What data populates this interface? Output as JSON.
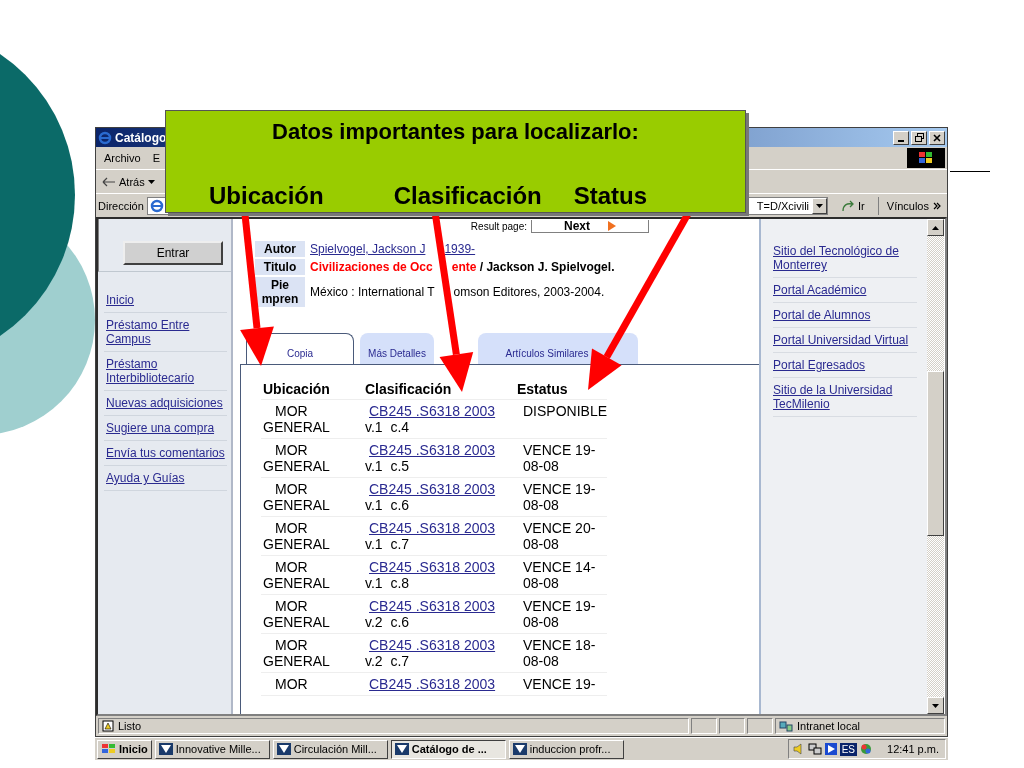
{
  "callout": {
    "heading": "Datos importantes para localizarlo:",
    "labels": [
      "Ubicación",
      "Clasificación",
      "Status"
    ]
  },
  "window": {
    "title": "Catálogo",
    "menu": [
      "Archivo",
      "E"
    ],
    "back": "Atrás",
    "address": {
      "label": "Dirección",
      "value": "T=D/Xcivili",
      "go": "Ir",
      "links": "Vínculos"
    }
  },
  "left_sidebar": {
    "button": "Entrar",
    "links": [
      "Inicio",
      "Préstamo Entre Campus",
      "Préstamo Interbibliotecario",
      "Nuevas adquisiciones",
      "Sugiere una compra",
      "Envía tus comentarios",
      "Ayuda y Guías"
    ]
  },
  "record": {
    "result_page": "Result page:",
    "next": "Next",
    "fields": [
      {
        "kind": "link",
        "label": "Autor",
        "parts": [
          "Spielvogel, Jackson J",
          "1939-"
        ]
      },
      {
        "kind": "title",
        "label": "Titulo",
        "parts": [
          "Civilizaciones de Occ",
          "ente"
        ],
        "rest": " / Jackson J. Spielvogel."
      },
      {
        "kind": "text",
        "label": "Pie mpren",
        "parts": [
          "México : International T",
          "omson Editores, 2003-2004."
        ]
      }
    ]
  },
  "tabs": [
    {
      "label": "Copia",
      "selected": true
    },
    {
      "label": "Más Detalles",
      "selected": false
    },
    {
      "label": "Artículos Similares",
      "selected": false
    }
  ],
  "copies": {
    "columns": [
      "Ubicación",
      "Clasificación",
      "Estatus"
    ],
    "rows": [
      {
        "location": "MOR GENERAL",
        "call_number": "CB245 .S6318 2003",
        "volume": "v.1  c.4",
        "status": "DISPONIBLE"
      },
      {
        "location": "MOR GENERAL",
        "call_number": "CB245 .S6318 2003",
        "volume": "v.1  c.5",
        "status": "VENCE 19-08-08"
      },
      {
        "location": "MOR GENERAL",
        "call_number": "CB245 .S6318 2003",
        "volume": "v.1  c.6",
        "status": "VENCE 19-08-08"
      },
      {
        "location": "MOR GENERAL",
        "call_number": "CB245 .S6318 2003",
        "volume": "v.1  c.7",
        "status": "VENCE 20-08-08"
      },
      {
        "location": "MOR GENERAL",
        "call_number": "CB245 .S6318 2003",
        "volume": "v.1  c.8",
        "status": "VENCE 14-08-08"
      },
      {
        "location": "MOR GENERAL",
        "call_number": "CB245 .S6318 2003",
        "volume": "v.2  c.6",
        "status": "VENCE 19-08-08"
      },
      {
        "location": "MOR GENERAL",
        "call_number": "CB245 .S6318 2003",
        "volume": "v.2  c.7",
        "status": "VENCE 18-08-08"
      },
      {
        "location": "MOR",
        "call_number": "CB245 .S6318 2003",
        "status": "VENCE 19-"
      }
    ]
  },
  "right_sidebar": {
    "links": [
      "Sitio del Tecnológico de Monterrey",
      "Portal Académico",
      "Portal de Alumnos",
      "Portal Universidad Virtual",
      "Portal Egresados",
      "Sitio de la Universidad TecMilenio"
    ]
  },
  "status_bar": {
    "text": "Listo",
    "zone": "Intranet local"
  },
  "taskbar": {
    "start": "Inicio",
    "tasks": [
      {
        "label": "Innovative Mille...",
        "selected": false
      },
      {
        "label": "Circulación Mill...",
        "selected": false
      },
      {
        "label": "Catálogo de ...",
        "selected": true
      },
      {
        "label": "induccion profr...",
        "selected": false
      }
    ],
    "language": "ES",
    "clock": "12:41 p.m."
  }
}
